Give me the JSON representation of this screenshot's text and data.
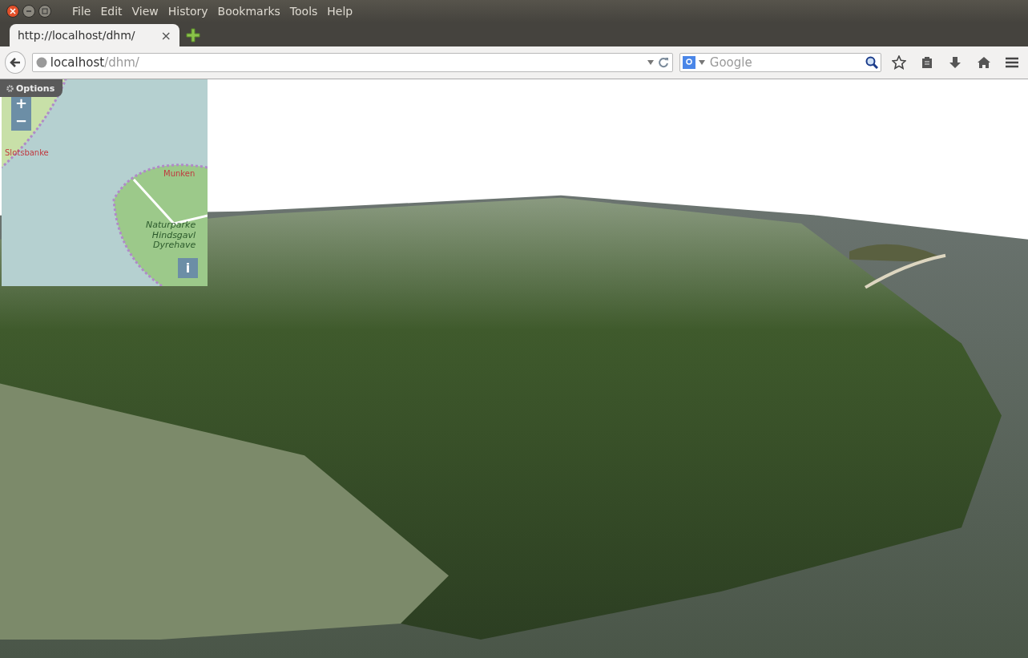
{
  "menu": [
    "File",
    "Edit",
    "View",
    "History",
    "Bookmarks",
    "Tools",
    "Help"
  ],
  "tabs": [
    {
      "title": "http://localhost/dhm/",
      "selected": true,
      "close": "×"
    }
  ],
  "address": {
    "host": "localhost",
    "path": "/dhm/"
  },
  "search": {
    "placeholder": "Google"
  },
  "map": {
    "options": "Options",
    "zoom_in": "+",
    "zoom_out": "−",
    "info": "i",
    "labels": [
      {
        "text": "Slotsbanke",
        "kind": "place"
      },
      {
        "text": "Munken",
        "kind": "place"
      },
      {
        "text": "Naturparke\nHindsgavl\nDyrehave",
        "kind": "park"
      }
    ]
  }
}
